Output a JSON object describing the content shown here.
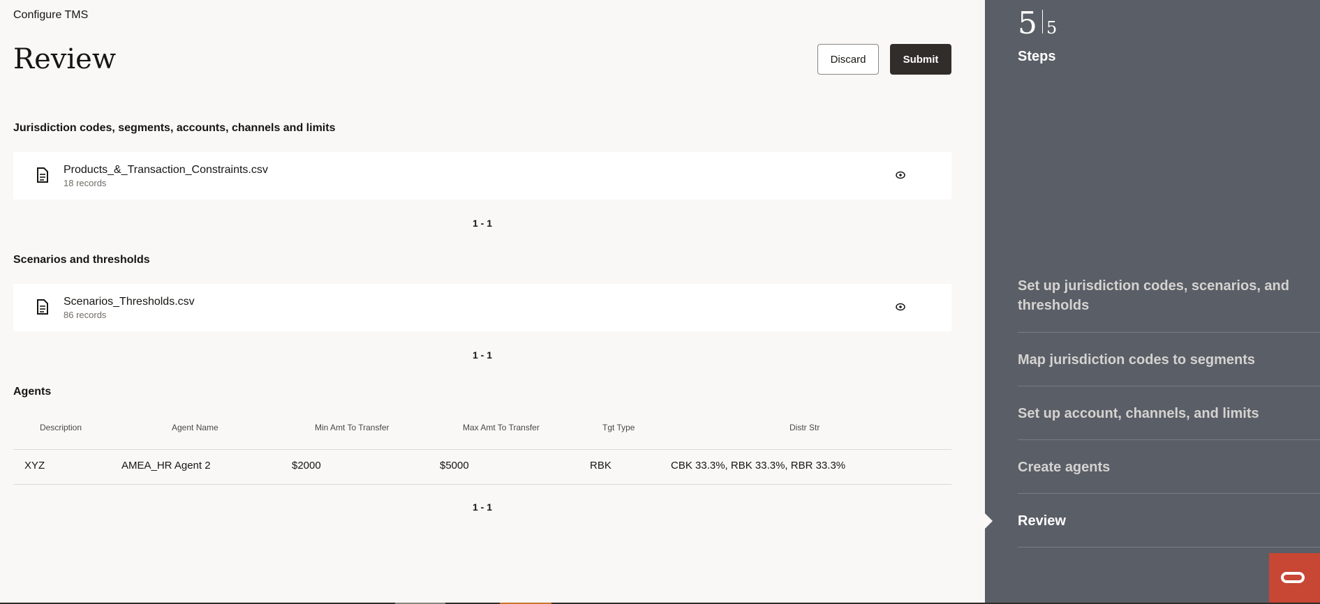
{
  "breadcrumb": "Configure TMS",
  "page_title": "Review",
  "actions": {
    "discard": "Discard",
    "submit": "Submit"
  },
  "sections": [
    {
      "title": "Jurisdiction codes, segments, accounts, channels and limits",
      "file": {
        "name": "Products_&_Transaction_Constraints.csv",
        "records": "18 records",
        "icon": "document-icon",
        "view_icon": "eye-icon"
      },
      "pager": "1 - 1"
    },
    {
      "title": "Scenarios and thresholds",
      "file": {
        "name": "Scenarios_Thresholds.csv",
        "records": "86 records",
        "icon": "document-icon",
        "view_icon": "eye-icon"
      },
      "pager": "1 - 1"
    }
  ],
  "agents": {
    "title": "Agents",
    "columns": [
      "Description",
      "Agent Name",
      "Min Amt To Transfer",
      "Max Amt To Transfer",
      "Tgt Type",
      "Distr Str"
    ],
    "rows": [
      [
        "XYZ",
        "AMEA_HR Agent 2",
        "$2000",
        "$5000",
        "RBK",
        "CBK 33.3%, RBK 33.3%, RBR 33.3%"
      ]
    ],
    "pager": "1 - 1"
  },
  "sidebar": {
    "current_step": "5",
    "total_steps": "5",
    "label": "Steps",
    "steps": [
      {
        "label": "Set up jurisdiction codes, scenarios, and thresholds"
      },
      {
        "label": "Map jurisdiction codes to segments"
      },
      {
        "label": "Set up account, channels, and limits"
      },
      {
        "label": "Create agents"
      },
      {
        "label": "Review"
      }
    ],
    "current_index": 4
  },
  "colors": {
    "sidebar_bg": "#5a5e66",
    "submit_bg": "#312d2a",
    "brand_red": "#c74634",
    "page_bg": "#f9f8f6"
  }
}
